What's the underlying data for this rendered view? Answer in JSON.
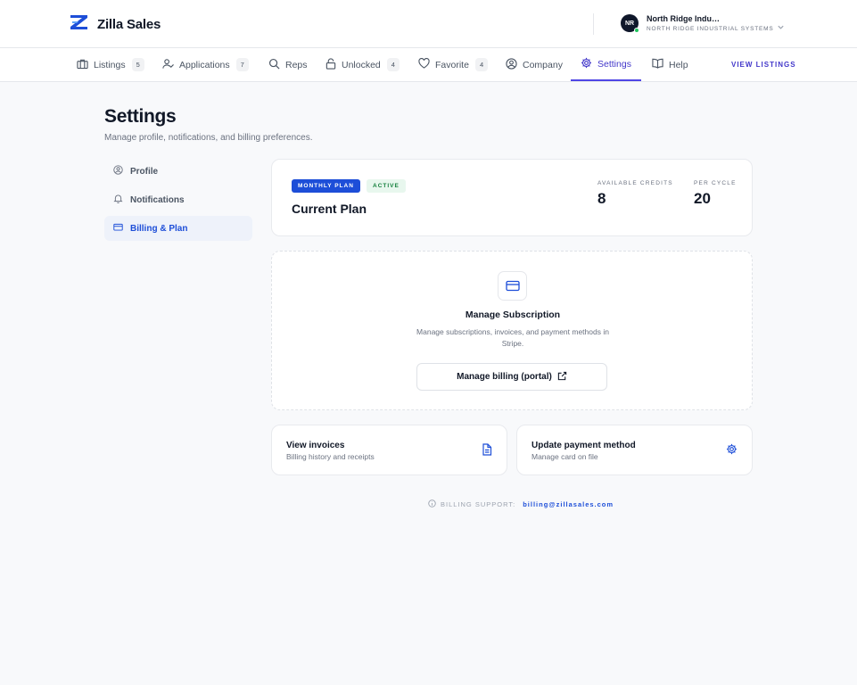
{
  "brand": {
    "name": "Zilla Sales",
    "accent": "#1d4ed8",
    "logo_icon": "zilla-z-logo"
  },
  "account": {
    "initials": "NR",
    "name": "North Ridge Indu…",
    "subtitle": "NORTH RIDGE INDUSTRIAL SYSTEMS",
    "status": "online"
  },
  "nav": {
    "items": [
      {
        "label": "Listings",
        "badge": "5",
        "icon": "briefcase-icon"
      },
      {
        "label": "Applications",
        "badge": "7",
        "icon": "user-check-icon"
      },
      {
        "label": "Reps",
        "icon": "search-icon"
      },
      {
        "label": "Unlocked",
        "badge": "4",
        "icon": "lock-icon"
      },
      {
        "label": "Favorite",
        "badge": "4",
        "icon": "heart-icon"
      },
      {
        "label": "Company",
        "icon": "user-circle-icon"
      },
      {
        "label": "Settings",
        "icon": "gear-icon",
        "active": true
      },
      {
        "label": "Help",
        "icon": "book-icon"
      }
    ],
    "view_listings": "VIEW LISTINGS"
  },
  "page": {
    "title": "Settings",
    "subtitle": "Manage profile, notifications, and billing preferences."
  },
  "sidebar": {
    "items": [
      {
        "label": "Profile",
        "icon": "user-circle-icon"
      },
      {
        "label": "Notifications",
        "icon": "bell-icon"
      },
      {
        "label": "Billing & Plan",
        "icon": "credit-card-icon",
        "active": true
      }
    ]
  },
  "plan": {
    "badge": "MONTHLY PLAN",
    "status": "ACTIVE",
    "title": "Current Plan",
    "credits_label": "AVAILABLE CREDITS",
    "credits_value": "8",
    "cycle_label": "PER CYCLE",
    "cycle_value": "20"
  },
  "subscription": {
    "title": "Manage Subscription",
    "description": "Manage subscriptions, invoices, and payment methods in Stripe.",
    "button": "Manage billing (portal)"
  },
  "actions": [
    {
      "title": "View invoices",
      "subtitle": "Billing history and receipts",
      "icon": "document-icon"
    },
    {
      "title": "Update payment method",
      "subtitle": "Manage card on file",
      "icon": "gear-icon"
    }
  ],
  "support": {
    "label": "BILLING SUPPORT:",
    "email": "billing@zillasales.com"
  }
}
